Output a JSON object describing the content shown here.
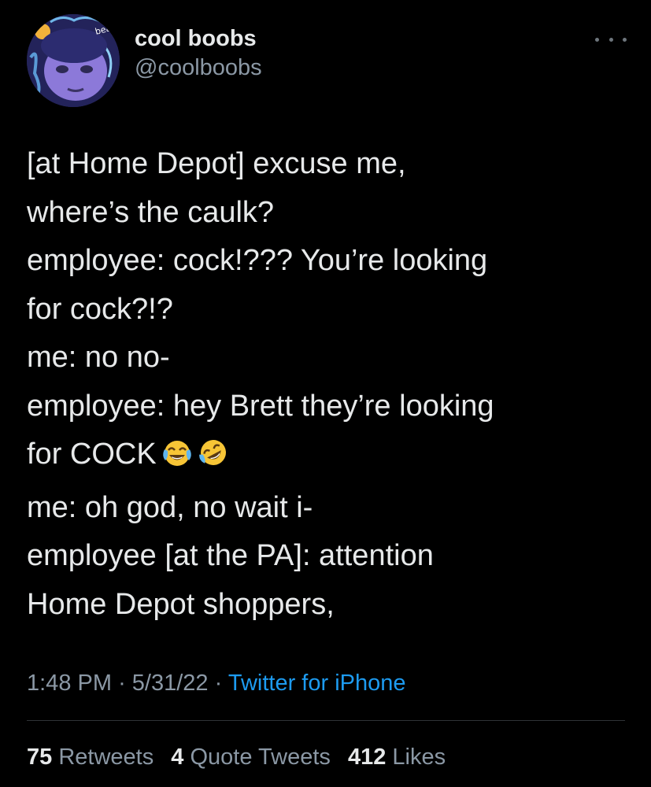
{
  "author": {
    "display_name": "cool boobs",
    "handle": "@coolboobs",
    "avatar_caption": "beachy day"
  },
  "tweet": {
    "lines": [
      "[at Home Depot] excuse me,",
      "where’s the caulk?",
      "employee: cock!??? You’re looking",
      "for cock?!?",
      "me: no no-",
      "employee: hey Brett they’re looking",
      "for COCK",
      "me: oh god, no wait i-",
      "employee [at the PA]: attention",
      "Home Depot shoppers,"
    ],
    "emojis": [
      "face-with-tears-of-joy-icon",
      "rolling-on-the-floor-laughing-icon"
    ]
  },
  "meta": {
    "time": "1:48 PM",
    "separator": "·",
    "date": "5/31/22",
    "source": "Twitter for iPhone"
  },
  "stats": {
    "retweets_count": "75",
    "retweets_label": "Retweets",
    "quotes_count": "4",
    "quotes_label": "Quote Tweets",
    "likes_count": "412",
    "likes_label": "Likes"
  },
  "colors": {
    "background": "#000000",
    "text": "#e7e9ea",
    "secondary": "#8b98a5",
    "link": "#1d9bf0",
    "divider": "#2f3336"
  }
}
